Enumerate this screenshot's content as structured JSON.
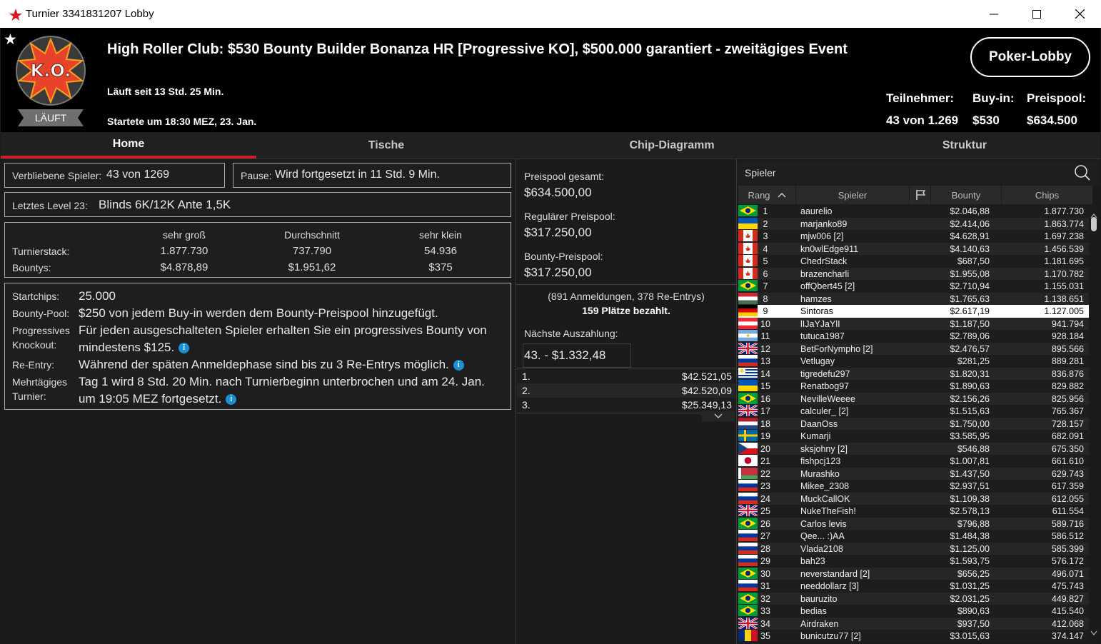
{
  "window": {
    "title": "Turnier 3341831207 Lobby"
  },
  "header": {
    "badge": "LÄUFT",
    "logo_text": "K.O.",
    "title": "High Roller Club: $530 Bounty Builder Bonanza HR [Progressive KO], $500.000 garantiert - zweitägiges Event",
    "running": "Läuft seit 13 Std. 25 Min.",
    "started": "Startete um 18:30 MEZ, 23. Jan.",
    "lobby_button": "Poker-Lobby",
    "stats": [
      {
        "label": "Teilnehmer:",
        "value": "43 von 1.269"
      },
      {
        "label": "Buy-in:",
        "value": "$530"
      },
      {
        "label": "Preispool:",
        "value": "$634.500"
      }
    ]
  },
  "tabs": [
    "Home",
    "Tische",
    "Chip-Diagramm",
    "Struktur"
  ],
  "left": {
    "remaining_label": "Verbliebene Spieler:",
    "remaining_value": "43 von 1269",
    "pause_label": "Pause:",
    "pause_value": "Wird fortgesetzt in 11 Std. 9 Min.",
    "level_label": "Letztes Level 23:",
    "level_value": "Blinds 6K/12K Ante 1,5K",
    "stack_headers": [
      "sehr groß",
      "Durchschnitt",
      "sehr klein"
    ],
    "stack_label": "Turnierstack:",
    "stack_values": [
      "1.877.730",
      "737.790",
      "54.936"
    ],
    "bounty_label": "Bountys:",
    "bounty_values": [
      "$4.878,89",
      "$1.951,62",
      "$375"
    ],
    "startchips_label": "Startchips:",
    "startchips_value": "25.000",
    "bountypool_label": "Bounty-Pool:",
    "bountypool_value": "$250 von jedem Buy-in werden dem Bounty-Preispool hinzugefügt.",
    "pko_label1": "Progressives",
    "pko_label2": "Knockout:",
    "pko_value1": "Für jeden ausgeschalteten Spieler erhalten Sie ein progressives Bounty von",
    "pko_value2": "mindestens $125.",
    "reentry_label": "Re-Entry:",
    "reentry_value": "Während der späten Anmeldephase sind bis zu 3 Re-Entrys möglich.",
    "multi_label1": "Mehrtägiges",
    "multi_label2": "Turnier:",
    "multi_value1": "Tag 1 wird 8 Std. 20 Min. nach Turnierbeginn unterbrochen und am 24. Jan.",
    "multi_value2": "um 19:05 MEZ fortgesetzt."
  },
  "mid": {
    "total_label": "Preispool gesamt:",
    "total_value": "$634.500,00",
    "regular_label": "Regulärer Preispool:",
    "regular_value": "$317.250,00",
    "bounty_label": "Bounty-Preispool:",
    "bounty_value": "$317.250,00",
    "entries": "(891 Anmeldungen, 378 Re-Entrys)",
    "paid": "159 Plätze bezahlt.",
    "next_label": "Nächste Auszahlung:",
    "next_value": "43. - $1.332,48",
    "payouts": [
      {
        "place": "1.",
        "amount": "$42.521,05"
      },
      {
        "place": "2.",
        "amount": "$42.520,09"
      },
      {
        "place": "3.",
        "amount": "$25.349,13"
      }
    ]
  },
  "players": {
    "search_label": "Spieler",
    "columns": [
      "Rang",
      "Spieler",
      "Bounty",
      "Chips"
    ],
    "rows": [
      {
        "rank": "1",
        "name": "aaurelio",
        "flag": "br",
        "bounty": "$2.046,88",
        "chips": "1.877.730"
      },
      {
        "rank": "2",
        "name": "marjanko89",
        "flag": "ua",
        "bounty": "$2.414,06",
        "chips": "1.863.774"
      },
      {
        "rank": "3",
        "name": "mjw006 [2]",
        "flag": "ca",
        "bounty": "$4.628,91",
        "chips": "1.697.238"
      },
      {
        "rank": "4",
        "name": "kn0wlEdge911",
        "flag": "ca",
        "bounty": "$4.140,63",
        "chips": "1.456.539"
      },
      {
        "rank": "5",
        "name": "ChedrStack",
        "flag": "ca",
        "bounty": "$687,50",
        "chips": "1.181.695"
      },
      {
        "rank": "6",
        "name": "brazencharli",
        "flag": "ca",
        "bounty": "$1.955,08",
        "chips": "1.170.782"
      },
      {
        "rank": "7",
        "name": "offQbert45 [2]",
        "flag": "br",
        "bounty": "$2.710,94",
        "chips": "1.155.031"
      },
      {
        "rank": "8",
        "name": "hamzes",
        "flag": "hu",
        "bounty": "$1.765,63",
        "chips": "1.138.651"
      },
      {
        "rank": "9",
        "name": "Sintoras",
        "flag": "de",
        "bounty": "$2.617,19",
        "chips": "1.127.005"
      },
      {
        "rank": "10",
        "name": "lIJaYJaYlI",
        "flag": "at",
        "bounty": "$1.187,50",
        "chips": "941.794"
      },
      {
        "rank": "11",
        "name": "tutuca1987",
        "flag": "ar",
        "bounty": "$2.789,06",
        "chips": "928.184"
      },
      {
        "rank": "12",
        "name": "BetForNympho [2]",
        "flag": "gb",
        "bounty": "$2.476,57",
        "chips": "895.566"
      },
      {
        "rank": "13",
        "name": "Vetlugay",
        "flag": "ru",
        "bounty": "$281,25",
        "chips": "889.281"
      },
      {
        "rank": "14",
        "name": "tigredefu297",
        "flag": "uy",
        "bounty": "$1.820,31",
        "chips": "836.876"
      },
      {
        "rank": "15",
        "name": "Renatbog97",
        "flag": "ua",
        "bounty": "$1.890,63",
        "chips": "829.882"
      },
      {
        "rank": "16",
        "name": "NevilleWeeee",
        "flag": "br",
        "bounty": "$2.156,26",
        "chips": "825.956"
      },
      {
        "rank": "17",
        "name": "calculer_ [2]",
        "flag": "gb",
        "bounty": "$1.515,63",
        "chips": "765.367"
      },
      {
        "rank": "18",
        "name": "DaanOss",
        "flag": "nl",
        "bounty": "$1.750,00",
        "chips": "728.157"
      },
      {
        "rank": "19",
        "name": "Kumarji",
        "flag": "se",
        "bounty": "$3.585,95",
        "chips": "682.091"
      },
      {
        "rank": "20",
        "name": "sksjohny [2]",
        "flag": "cz",
        "bounty": "$546,88",
        "chips": "675.350"
      },
      {
        "rank": "21",
        "name": "fishpcj123",
        "flag": "jp",
        "bounty": "$1.007,81",
        "chips": "661.610"
      },
      {
        "rank": "22",
        "name": "Murashko",
        "flag": "by",
        "bounty": "$1.437,50",
        "chips": "629.743"
      },
      {
        "rank": "23",
        "name": "Mikee_2308",
        "flag": "ru",
        "bounty": "$2.937,51",
        "chips": "617.359"
      },
      {
        "rank": "24",
        "name": "MuckCallOK",
        "flag": "ru",
        "bounty": "$1.109,38",
        "chips": "612.055"
      },
      {
        "rank": "25",
        "name": "NukeTheFish!",
        "flag": "gb",
        "bounty": "$2.578,13",
        "chips": "611.554"
      },
      {
        "rank": "26",
        "name": "Carlos levis",
        "flag": "br",
        "bounty": "$796,88",
        "chips": "589.716"
      },
      {
        "rank": "27",
        "name": "Qee... :)AA",
        "flag": "ru",
        "bounty": "$1.484,38",
        "chips": "586.512"
      },
      {
        "rank": "28",
        "name": "Vlada2108",
        "flag": "ru",
        "bounty": "$1.125,00",
        "chips": "585.399"
      },
      {
        "rank": "29",
        "name": "bah23",
        "flag": "ru",
        "bounty": "$1.593,75",
        "chips": "576.172"
      },
      {
        "rank": "30",
        "name": "neverstandard [2]",
        "flag": "br",
        "bounty": "$656,25",
        "chips": "496.071"
      },
      {
        "rank": "31",
        "name": "needdollarz [3]",
        "flag": "ru",
        "bounty": "$1.031,25",
        "chips": "475.743"
      },
      {
        "rank": "32",
        "name": "bauruzito",
        "flag": "br",
        "bounty": "$2.031,25",
        "chips": "449.827"
      },
      {
        "rank": "33",
        "name": "bedias",
        "flag": "br",
        "bounty": "$890,63",
        "chips": "415.540"
      },
      {
        "rank": "34",
        "name": "Airdraken",
        "flag": "gb",
        "bounty": "$937,50",
        "chips": "412.068"
      },
      {
        "rank": "35",
        "name": "bunicutzu77 [2]",
        "flag": "ro",
        "bounty": "$3.015,63",
        "chips": "374.147"
      }
    ],
    "highlight_rank": "9"
  },
  "colors": {
    "accent": "#cc1e2b",
    "header_bg": "#000000",
    "panel_bg": "#1b1b1b",
    "info": "#1a8fd6"
  }
}
